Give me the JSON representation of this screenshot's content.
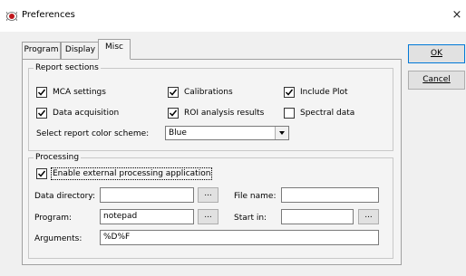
{
  "window": {
    "title": "Preferences",
    "close_glyph": "×",
    "app_icon": "record-icon"
  },
  "tabs": [
    {
      "label": "Program",
      "active": false
    },
    {
      "label": "Display",
      "active": false
    },
    {
      "label": "Misc",
      "active": true
    }
  ],
  "report_sections": {
    "title": "Report sections",
    "checkboxes": [
      {
        "label": "MCA settings",
        "checked": true
      },
      {
        "label": "Calibrations",
        "checked": true
      },
      {
        "label": "Include Plot",
        "checked": true
      },
      {
        "label": "Data acquisition",
        "checked": true
      },
      {
        "label": "ROI analysis results",
        "checked": true
      },
      {
        "label": "Spectral data",
        "checked": false
      }
    ],
    "color_scheme_label": "Select report color scheme:",
    "color_scheme_value": "Blue"
  },
  "processing": {
    "title": "Processing",
    "enable_label": "Enable external processing application",
    "enable_checked": true,
    "data_directory_label": "Data directory:",
    "data_directory_value": "",
    "file_name_label": "File name:",
    "file_name_value": "",
    "program_label": "Program:",
    "program_value": "notepad",
    "start_in_label": "Start in:",
    "start_in_value": "",
    "arguments_label": "Arguments:",
    "arguments_value": "%D%F",
    "browse_label": "..."
  },
  "buttons": {
    "ok_label": "OK",
    "cancel_label": "Cancel"
  },
  "colors": {
    "focus_border": "#0078d7",
    "icon_red": "#c0151b"
  }
}
